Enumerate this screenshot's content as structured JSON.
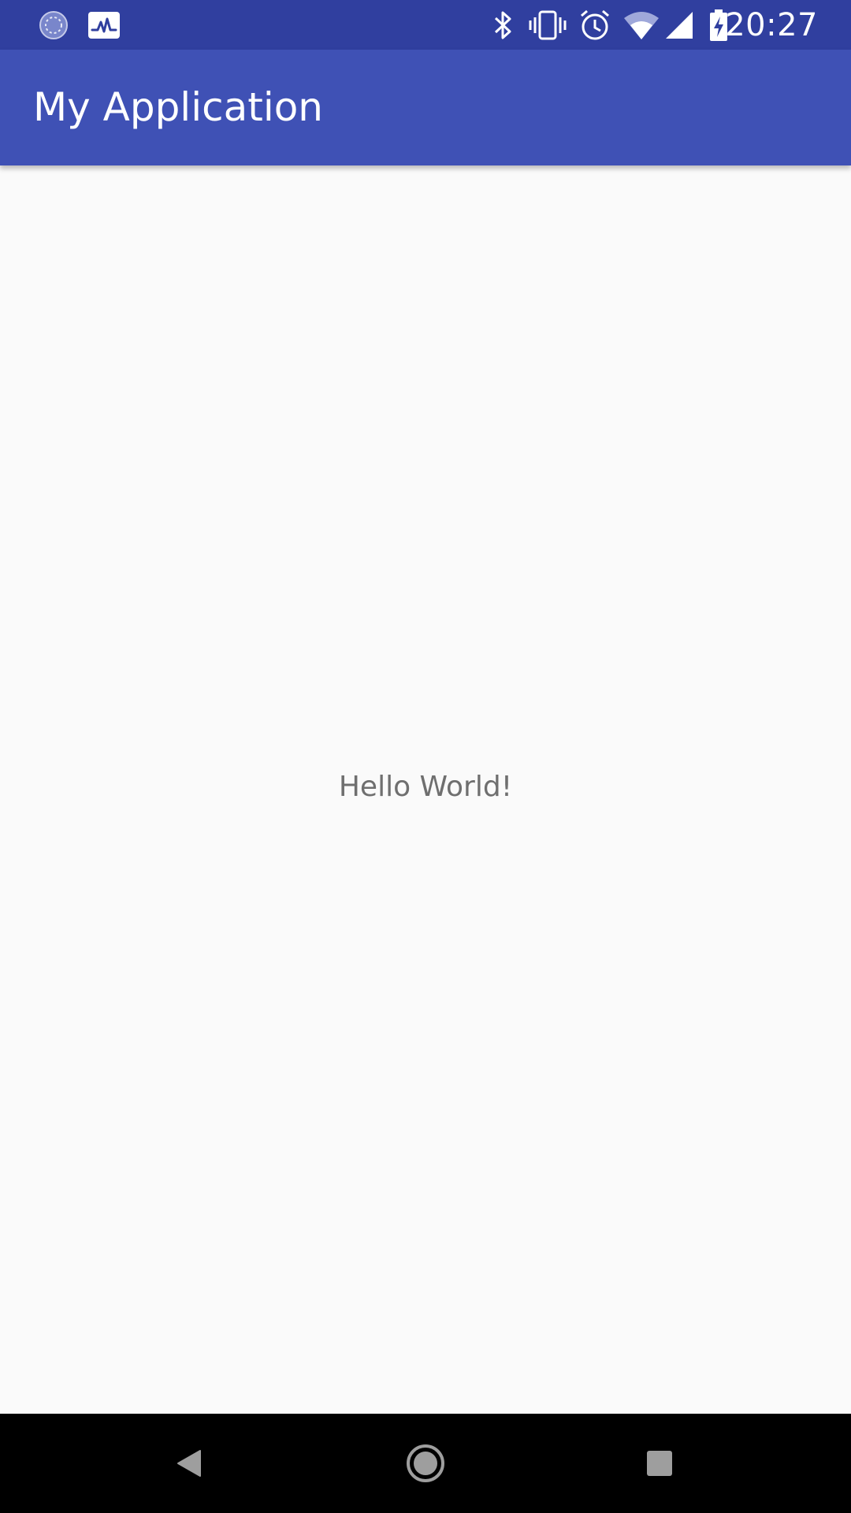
{
  "status_bar": {
    "time": "20:27",
    "left_icons": [
      "sync-icon",
      "activity-chart-icon"
    ],
    "right_icons": [
      "bluetooth-icon",
      "vibrate-icon",
      "alarm-icon",
      "wifi-icon",
      "cellular-signal-icon",
      "battery-charging-icon"
    ]
  },
  "app_bar": {
    "title": "My Application",
    "color": "#3f51b5",
    "status_color": "#303f9f"
  },
  "main": {
    "text": "Hello World!"
  },
  "nav_bar": {
    "buttons": [
      "back-button",
      "home-button",
      "recents-button"
    ]
  }
}
